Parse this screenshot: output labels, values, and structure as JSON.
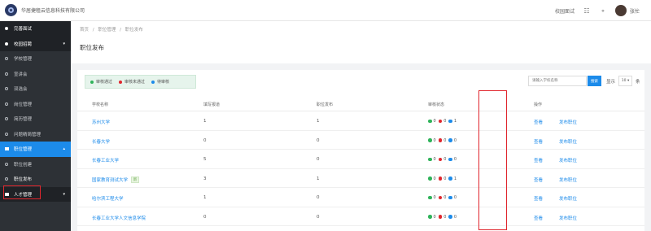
{
  "topbar": {
    "company": "华居捷租云信息科技有限公司",
    "switch_link": "校园面试",
    "icons": [
      "grid-icon",
      "bell-icon"
    ],
    "username": "张忙"
  },
  "sidebar": {
    "items": [
      {
        "label": "完善面试",
        "type": "group",
        "icon": "dot"
      },
      {
        "label": "校园招聘",
        "type": "group",
        "icon": "dot",
        "caret": "▾"
      },
      {
        "label": "学校管理",
        "type": "sub"
      },
      {
        "label": "宣讲会",
        "type": "sub"
      },
      {
        "label": "双选会",
        "type": "sub"
      },
      {
        "label": "岗位管理",
        "type": "sub"
      },
      {
        "label": "简历管理",
        "type": "sub"
      },
      {
        "label": "问题精简管理",
        "type": "sub"
      },
      {
        "label": "职位管理",
        "type": "active",
        "icon": "sq",
        "caret": "▴"
      },
      {
        "label": "职位创建",
        "type": "sub"
      },
      {
        "label": "职位发布",
        "type": "selected"
      },
      {
        "label": "人才管理",
        "type": "group",
        "icon": "sq",
        "caret": "▾"
      }
    ]
  },
  "breadcrumb": [
    "首页",
    "/",
    "职位管理",
    "/",
    "职位发布"
  ],
  "page_title": "职位发布",
  "legend": [
    {
      "label": "审核通过",
      "color": "#2fb35a"
    },
    {
      "label": "审核未通过",
      "color": "#e0262d"
    },
    {
      "label": "待审核",
      "color": "#1c8bea"
    }
  ],
  "search": {
    "placeholder": "请输入学校名称",
    "button": "搜索"
  },
  "pager": {
    "show_label": "显示",
    "page_size": "10 ▾",
    "unit": "条"
  },
  "table": {
    "headers": [
      "学校名称",
      "填写报道",
      "职位发布",
      "审核状态",
      "操作"
    ],
    "rows": [
      {
        "name": "苏州大学",
        "tag": "",
        "reports": "1",
        "posts": "1",
        "s_green": "0",
        "s_red": "0",
        "s_blue": "1"
      },
      {
        "name": "长春大学",
        "tag": "",
        "reports": "0",
        "posts": "0",
        "s_green": "0",
        "s_red": "0",
        "s_blue": "0"
      },
      {
        "name": "长春工业大学",
        "tag": "",
        "reports": "5",
        "posts": "0",
        "s_green": "0",
        "s_red": "0",
        "s_blue": "0"
      },
      {
        "name": "国家教育测试大学",
        "tag": "新",
        "reports": "3",
        "posts": "1",
        "s_green": "0",
        "s_red": "0",
        "s_blue": "1"
      },
      {
        "name": "哈尔滨工程大学",
        "tag": "",
        "reports": "1",
        "posts": "0",
        "s_green": "0",
        "s_red": "0",
        "s_blue": "0"
      },
      {
        "name": "长春工业大学人文信息学院",
        "tag": "",
        "reports": "0",
        "posts": "0",
        "s_green": "0",
        "s_red": "0",
        "s_blue": "0"
      }
    ],
    "action_view": "查看",
    "action_publish": "发布职位"
  },
  "colors": {
    "accent": "#1c8bea",
    "sidebar_bg": "#2d3136",
    "highlight_box": "#e0262d"
  }
}
